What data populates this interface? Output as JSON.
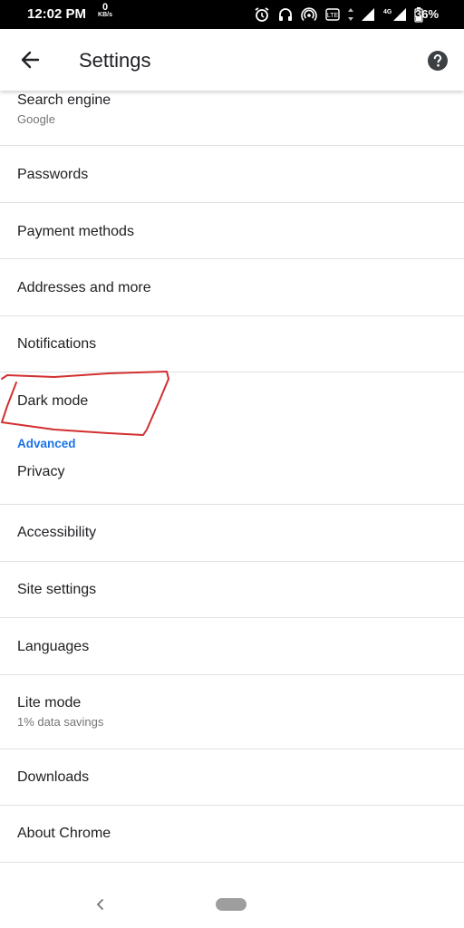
{
  "status_bar": {
    "time": "12:02 PM",
    "speed_value": "0",
    "speed_unit": "KB/s",
    "battery_percent": "36%",
    "network_label": "4G",
    "icons": [
      "alarm-icon",
      "headset-icon",
      "hotspot-icon",
      "volte-icon",
      "signal-icon",
      "battery-icon"
    ]
  },
  "app_bar": {
    "title": "Settings",
    "back_icon": "arrow-left-icon",
    "help_icon": "help-icon"
  },
  "settings": {
    "items_top": [
      {
        "label": "Search engine",
        "sub": "Google"
      },
      {
        "label": "Passwords"
      },
      {
        "label": "Payment methods"
      },
      {
        "label": "Addresses and more"
      },
      {
        "label": "Notifications"
      },
      {
        "label": "Dark mode"
      }
    ],
    "advanced_header": "Advanced",
    "items_advanced": [
      {
        "label": "Privacy"
      },
      {
        "label": "Accessibility"
      },
      {
        "label": "Site settings"
      },
      {
        "label": "Languages"
      },
      {
        "label": "Lite mode",
        "sub": "1% data savings"
      },
      {
        "label": "Downloads"
      },
      {
        "label": "About Chrome"
      }
    ]
  },
  "colors": {
    "accent": "#1a73e8",
    "annotation": "#d32f2f",
    "divider": "#e0e0e0"
  }
}
